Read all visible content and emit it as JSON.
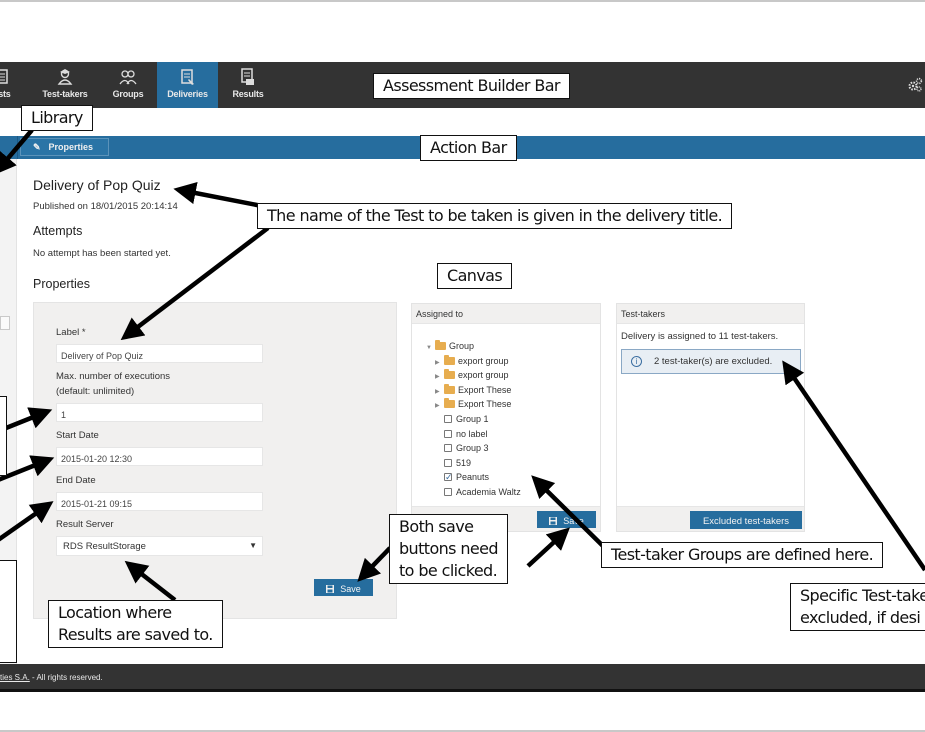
{
  "builder_bar": {
    "items": [
      {
        "label": "ests",
        "icon": "tests-icon",
        "active": false
      },
      {
        "label": "Test-takers",
        "icon": "test-taker-icon",
        "active": false
      },
      {
        "label": "Groups",
        "icon": "groups-icon",
        "active": false
      },
      {
        "label": "Deliveries",
        "icon": "deliveries-icon",
        "active": true
      },
      {
        "label": "Results",
        "icon": "results-icon",
        "active": false
      }
    ],
    "settings_icon": "gears-icon"
  },
  "action_bar": {
    "properties_label": "Properties",
    "properties_icon": "pencil-icon"
  },
  "main": {
    "title": "Delivery of Pop Quiz",
    "published": "Published on 18/01/2015 20:14:14",
    "attempts_heading": "Attempts",
    "attempts_text": "No attempt has been started yet.",
    "properties_heading": "Properties"
  },
  "form": {
    "label_label": "Label *",
    "label_value": "Delivery of Pop Quiz",
    "max_exec_label_1": "Max. number of executions",
    "max_exec_label_2": "(default: unlimited)",
    "max_exec_value": "1",
    "start_date_label": "Start Date",
    "start_date_value": "2015-01-20 12:30",
    "end_date_label": "End Date",
    "end_date_value": "2015-01-21 09:15",
    "result_server_label": "Result Server",
    "result_server_value": "RDS ResultStorage",
    "save_label": "Save"
  },
  "assigned": {
    "heading": "Assigned to",
    "root": "Group",
    "folders": [
      "export group",
      "export group",
      "Export These",
      "Export These"
    ],
    "groups": [
      {
        "label": "Group 1",
        "checked": false
      },
      {
        "label": "no label",
        "checked": false
      },
      {
        "label": "Group 3",
        "checked": false
      },
      {
        "label": "519",
        "checked": false
      },
      {
        "label": "Peanuts",
        "checked": true
      },
      {
        "label": "Academia Waltz",
        "checked": false
      }
    ],
    "save_label": "Save"
  },
  "test_takers": {
    "heading": "Test-takers",
    "assigned_text": "Delivery is assigned to 11 test-takers.",
    "excluded_text": "2 test-taker(s) are excluded.",
    "excluded_button": "Excluded test-takers"
  },
  "footer": {
    "link": "ties S.A.",
    "text": " - All rights reserved."
  },
  "annotations": {
    "builder_bar": "Assessment Builder Bar",
    "library": "Library",
    "action_bar": "Action Bar",
    "delivery_title": "The name of the Test to be taken is given in the delivery title.",
    "canvas": "Canvas",
    "save_both_1": "Both save",
    "save_both_2": "buttons need",
    "save_both_3": "to be clicked.",
    "groups_defined": "Test-taker Groups are defined here.",
    "results_location_1": "Location where",
    "results_location_2": "Results are saved to.",
    "excluded_1": "Specific Test-take",
    "excluded_2": "excluded, if desi"
  },
  "colors": {
    "builder_bar_bg": "#333333",
    "accent_blue": "#266d9e",
    "panel_bg": "#f1f0ef",
    "folder": "#e7ad4f"
  }
}
